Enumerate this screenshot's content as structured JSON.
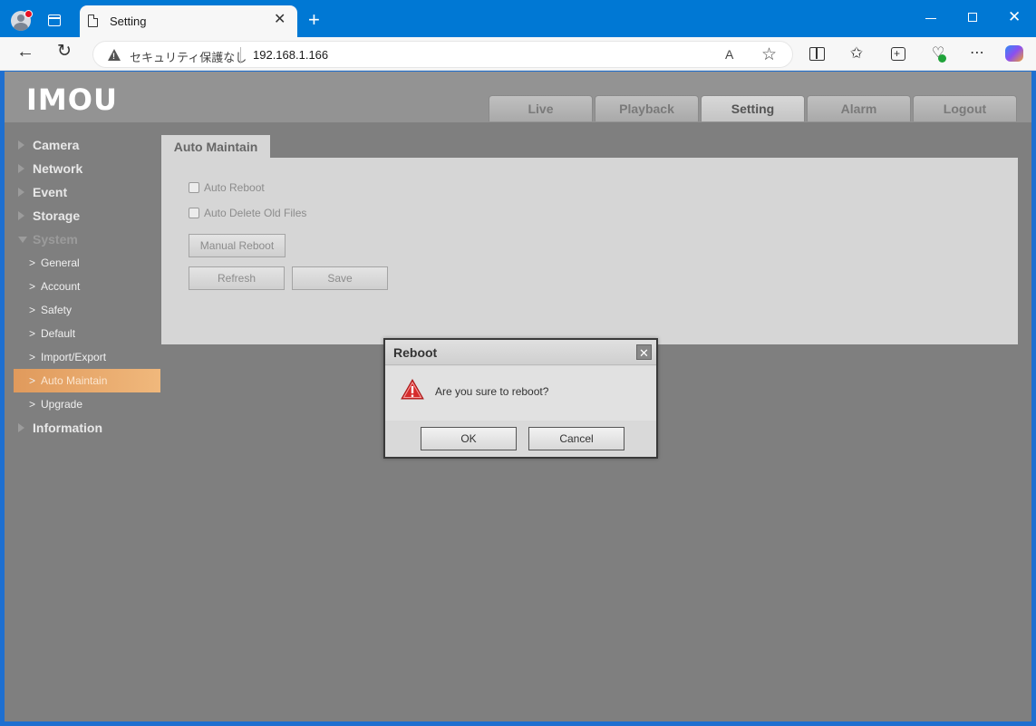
{
  "browser": {
    "tab_title": "Setting",
    "tab_close": "✕",
    "new_tab": "+",
    "security_text": "セキュリティ保護なし",
    "url": "192.168.1.166",
    "read_aloud": "A",
    "win_close": "✕"
  },
  "app": {
    "logo": "IMOU",
    "nav_tabs": [
      "Live",
      "Playback",
      "Setting",
      "Alarm",
      "Logout"
    ],
    "active_nav": "Setting"
  },
  "sidebar": {
    "menu": [
      {
        "label": "Camera"
      },
      {
        "label": "Network"
      },
      {
        "label": "Event"
      },
      {
        "label": "Storage"
      },
      {
        "label": "System"
      }
    ],
    "system_items": [
      "General",
      "Account",
      "Safety",
      "Default",
      "Import/Export",
      "Auto Maintain",
      "Upgrade"
    ],
    "active_item": "Auto Maintain",
    "information": "Information"
  },
  "content": {
    "tab_label": "Auto Maintain",
    "auto_reboot_label": "Auto Reboot",
    "auto_reboot_checked": false,
    "auto_delete_label": "Auto Delete Old Files",
    "auto_delete_checked": false,
    "manual_reboot_label": "Manual Reboot",
    "refresh_label": "Refresh",
    "save_label": "Save"
  },
  "dialog": {
    "title": "Reboot",
    "close": "✕",
    "message": "Are you sure to reboot?",
    "ok_label": "OK",
    "cancel_label": "Cancel"
  },
  "colors": {
    "chrome_blue": "#0078d4",
    "page_bg": "#7f7f7f",
    "active_menu": "#e8a66a",
    "warning_red": "#d62b2b"
  }
}
